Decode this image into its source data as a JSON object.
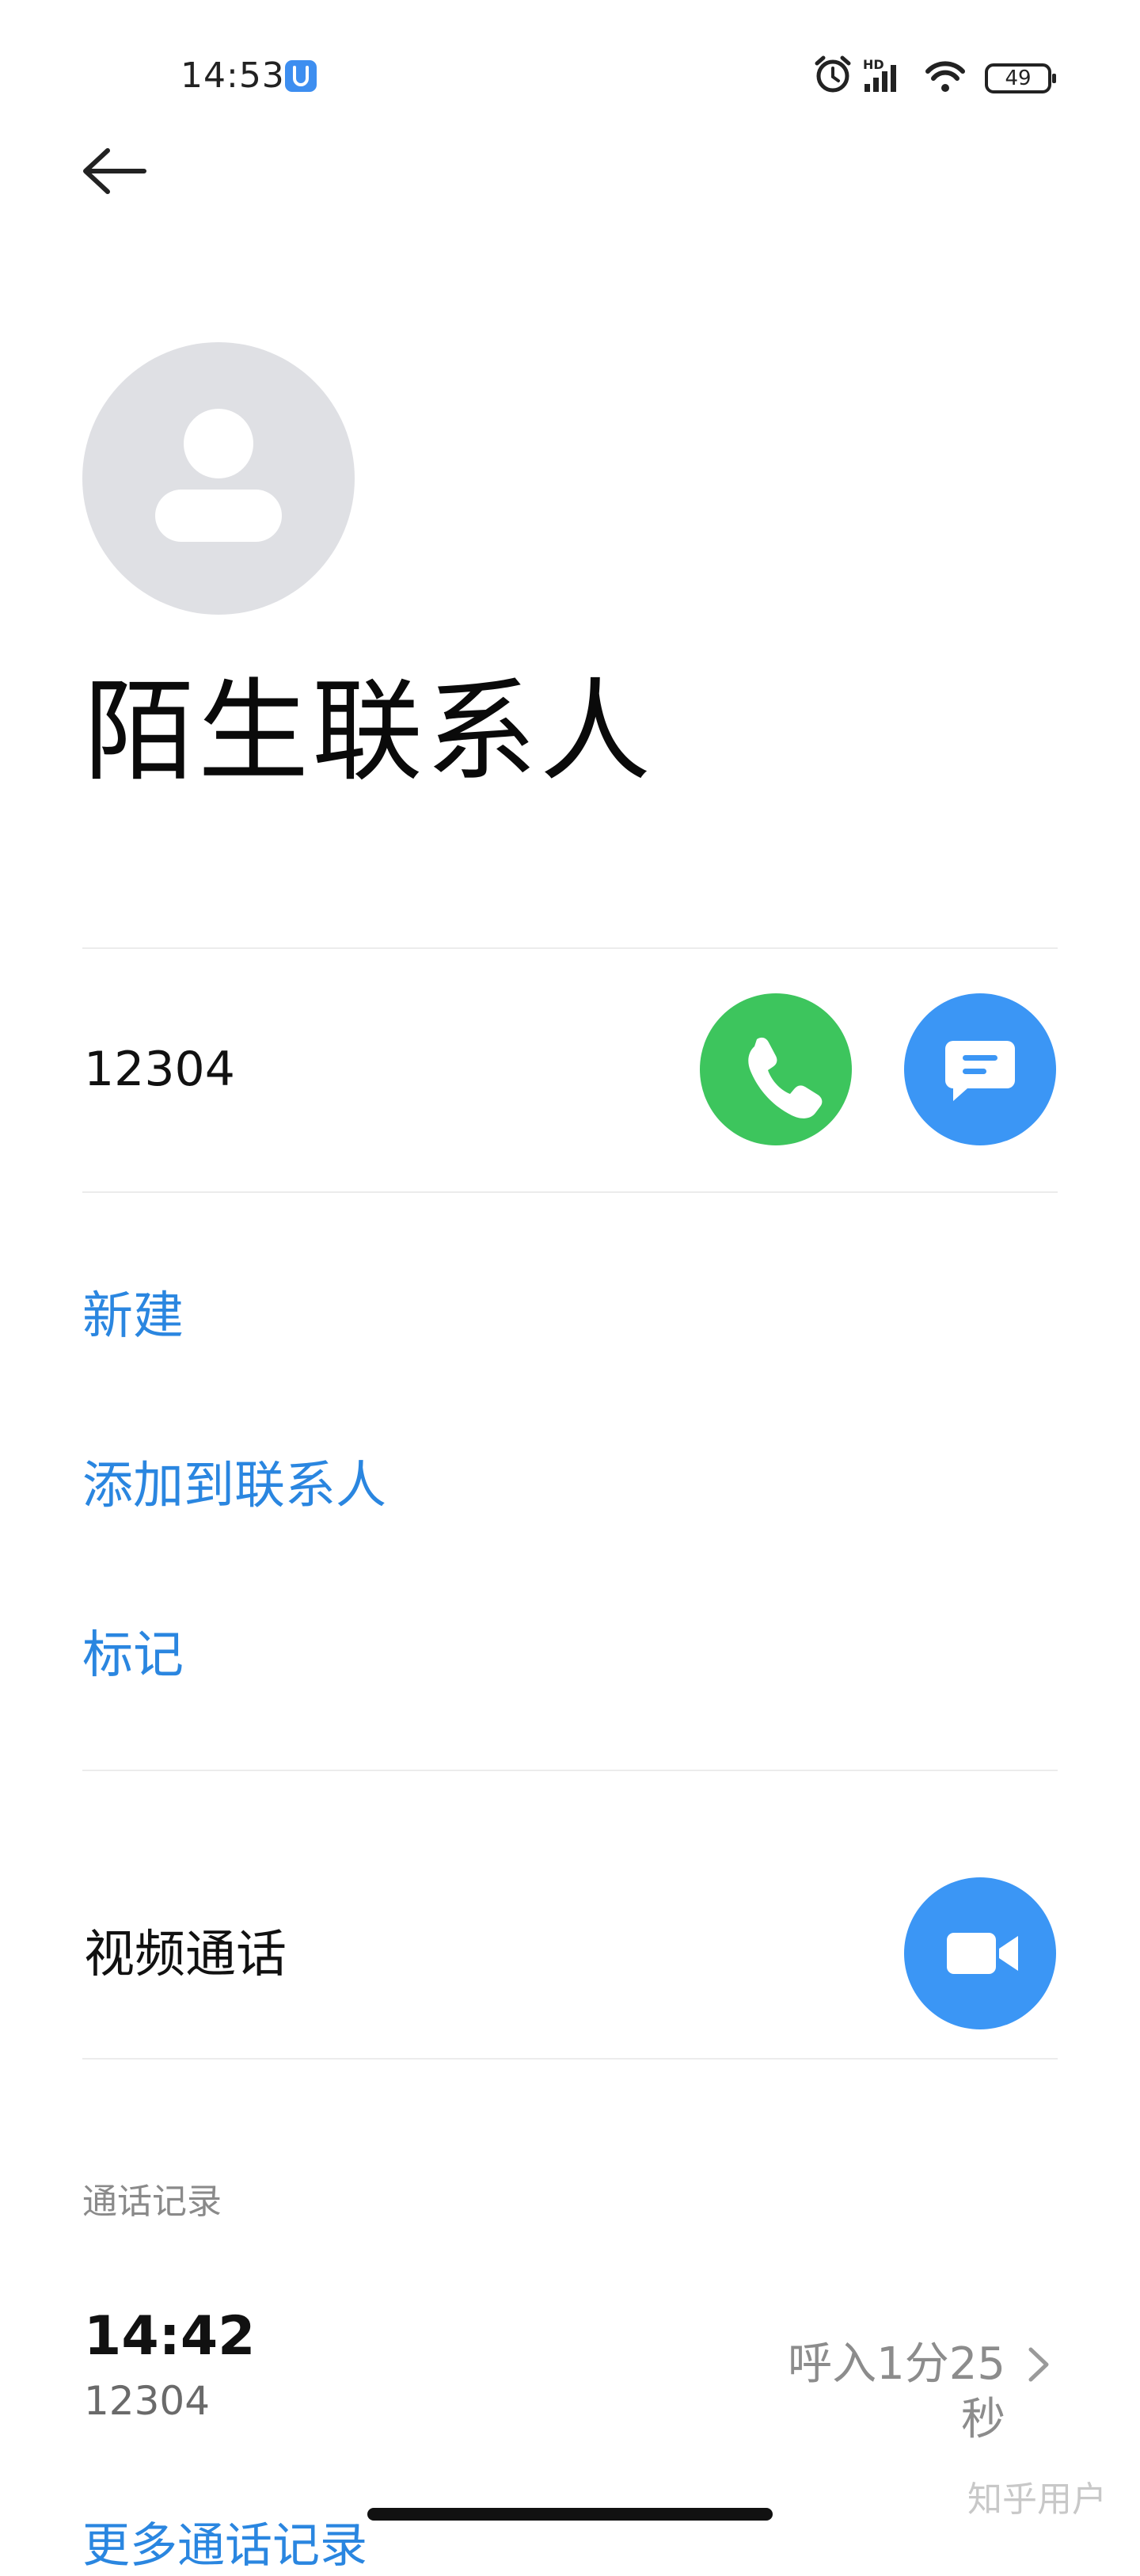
{
  "status_bar": {
    "time": "14:53",
    "network_label": "HD",
    "battery": "49"
  },
  "contact": {
    "name": "陌生联系人",
    "phone": "12304"
  },
  "actions": {
    "new_label": "新建",
    "add_to_contacts_label": "添加到联系人",
    "mark_label": "标记"
  },
  "video_call": {
    "label": "视频通话"
  },
  "call_log": {
    "section_title": "通话记录",
    "entries": [
      {
        "time": "14:42",
        "number": "12304",
        "detail": "呼入1分25秒"
      }
    ],
    "more_label": "更多通话记录"
  },
  "watermark": "知乎用户",
  "colors": {
    "call_button": "#3dc55d",
    "accent_blue": "#3b96f5",
    "link_blue": "#2a86e0",
    "avatar_bg": "#dfe0e4"
  },
  "icons": {
    "back": "arrow-left-icon",
    "call": "phone-icon",
    "message": "message-icon",
    "video": "video-camera-icon",
    "chevron": "chevron-right-icon"
  }
}
